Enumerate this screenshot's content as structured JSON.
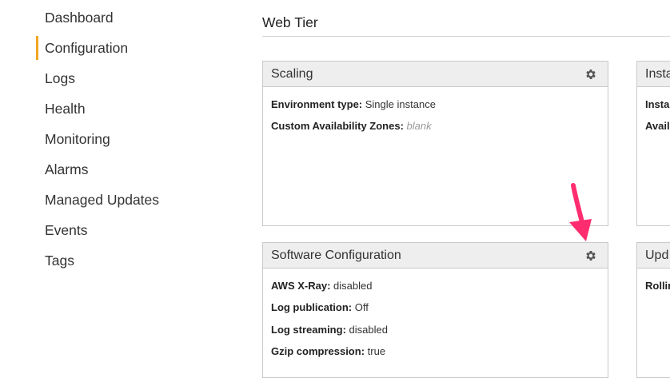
{
  "sidebar": {
    "items": [
      {
        "label": "Dashboard"
      },
      {
        "label": "Configuration",
        "active": true
      },
      {
        "label": "Logs"
      },
      {
        "label": "Health"
      },
      {
        "label": "Monitoring"
      },
      {
        "label": "Alarms"
      },
      {
        "label": "Managed Updates"
      },
      {
        "label": "Events"
      },
      {
        "label": "Tags"
      }
    ],
    "active_color": "#f5a623"
  },
  "main": {
    "section_title": "Web Tier",
    "panels": {
      "scaling": {
        "title": "Scaling",
        "fields": [
          {
            "label": "Environment type:",
            "value": "Single instance"
          },
          {
            "label": "Custom Availability Zones:",
            "value": "blank"
          }
        ]
      },
      "instances": {
        "title": "Insta",
        "fields": [
          {
            "label": "Insta"
          },
          {
            "label": "Avail"
          }
        ]
      },
      "software": {
        "title": "Software Configuration",
        "fields": [
          {
            "label": "AWS X-Ray:",
            "value": "disabled"
          },
          {
            "label": "Log publication:",
            "value": "Off"
          },
          {
            "label": "Log streaming:",
            "value": "disabled"
          },
          {
            "label": "Gzip compression:",
            "value": "true"
          }
        ]
      },
      "updates": {
        "title": "Upd",
        "fields": [
          {
            "label": "Rollin"
          }
        ]
      }
    }
  },
  "icons": {
    "gear": "gear-icon",
    "annotation": "pink-arrow"
  },
  "colors": {
    "arrow": "#ff2d6f",
    "header_bg": "#eeeeee",
    "border": "#c9c9c9"
  }
}
